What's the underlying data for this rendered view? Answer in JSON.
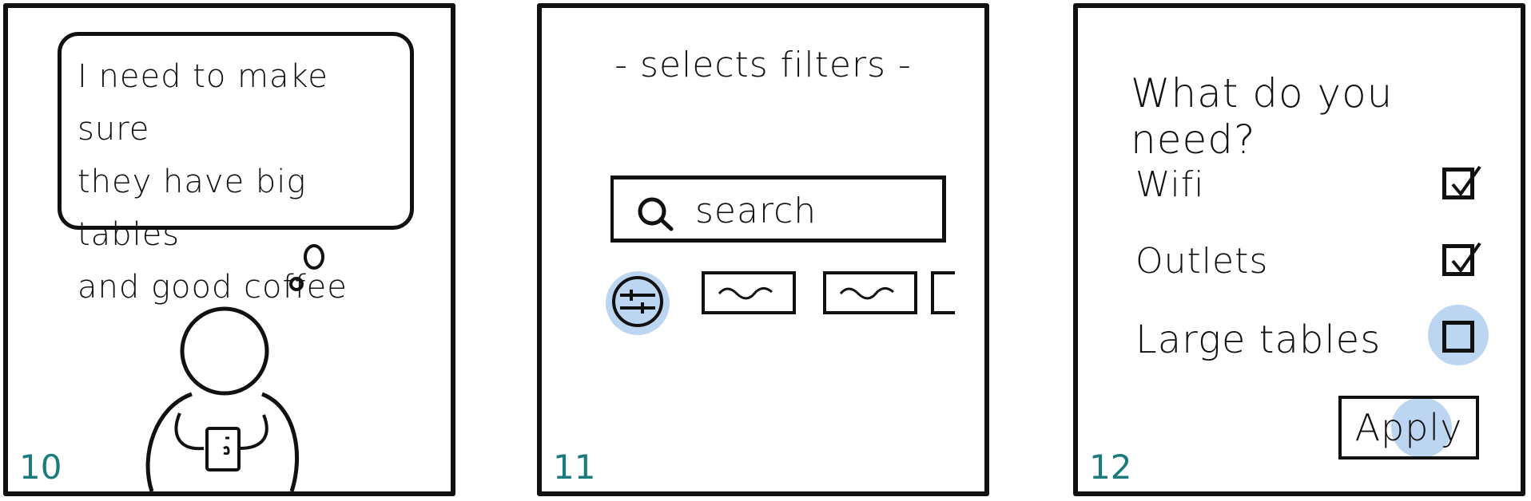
{
  "panels": [
    {
      "number": "10",
      "thought_bubble": "I need to make sure\nthey have big tables\nand good coffee"
    },
    {
      "number": "11",
      "title": "- selects filters -",
      "search_placeholder": "search"
    },
    {
      "number": "12",
      "title": "What do you need?",
      "options": [
        {
          "label": "Wifi",
          "checked": true
        },
        {
          "label": "Outlets",
          "checked": true
        },
        {
          "label": "Large tables",
          "checked": false
        }
      ],
      "apply_label": "Apply"
    }
  ],
  "colors": {
    "highlight": "#bcd6f2",
    "panel_number": "#1a7a7c",
    "ink": "#111111"
  }
}
